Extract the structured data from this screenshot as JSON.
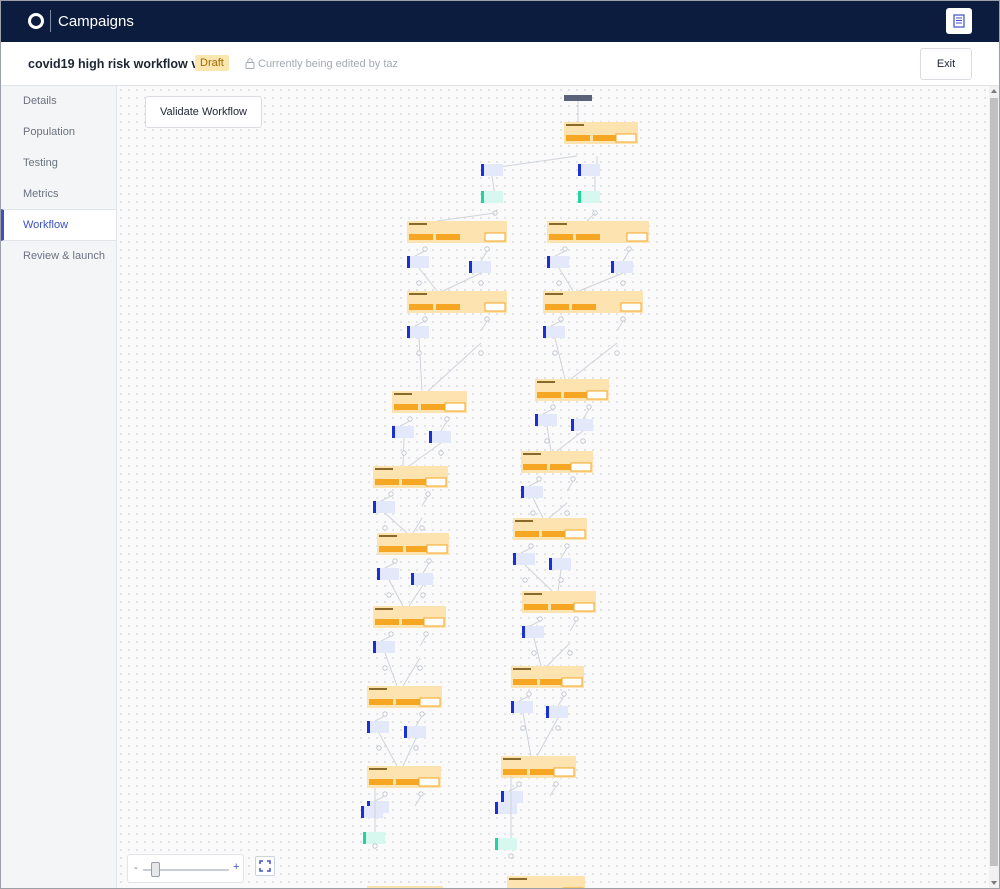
{
  "app": {
    "title": "Campaigns",
    "logo_icon": "ring-logo-icon",
    "docs_icon": "document-icon"
  },
  "header": {
    "workflow_title": "covid19 high risk workflow v1",
    "status_badge": "Draft",
    "lock_icon": "lock-icon",
    "edit_status": "Currently being edited by taz",
    "exit_label": "Exit"
  },
  "sidebar": {
    "items": [
      {
        "label": "Details",
        "active": false
      },
      {
        "label": "Population",
        "active": false
      },
      {
        "label": "Testing",
        "active": false
      },
      {
        "label": "Metrics",
        "active": false
      },
      {
        "label": "Workflow",
        "active": true
      },
      {
        "label": "Review & launch",
        "active": false
      }
    ]
  },
  "canvas": {
    "validate_label": "Validate Workflow",
    "zoom_minus": "-",
    "zoom_plus": "+",
    "zoom_level": 0.1,
    "fit_icon": "fit-to-screen-icon"
  },
  "colors": {
    "topbar": "#0b1c3e",
    "accent": "#3b50c8",
    "node_fill": "#fde3b0",
    "node_button": "#f5a623",
    "action_blue": "#1b2fd6",
    "action_fill": "#e3e9fb",
    "success_green": "#22d3a0",
    "success_fill": "#d6f8ee",
    "start_node": "#5a6378"
  }
}
